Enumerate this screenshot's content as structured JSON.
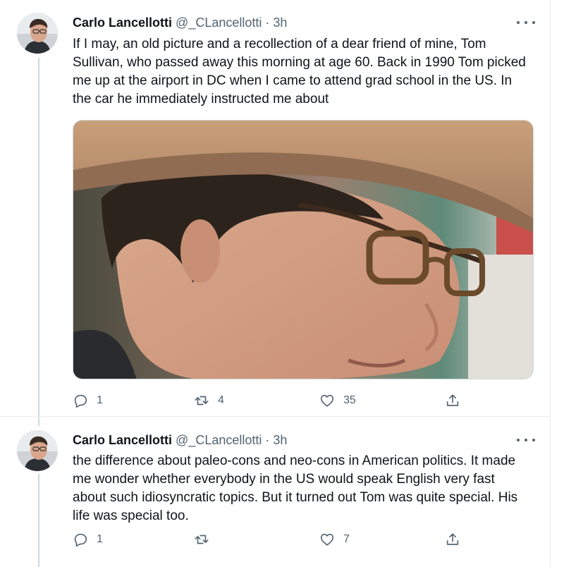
{
  "tweets": [
    {
      "author_name": "Carlo Lancellotti",
      "handle": "@_CLancellotti",
      "separator": "·",
      "time": "3h",
      "text": "If I may, an old picture and a recollection of a dear friend of mine, Tom Sullivan, who passed away this morning at age 60. Back in 1990 Tom picked me up at the airport in DC when I came to attend grad school in the US. In the car he immediately instructed me about",
      "has_media": true,
      "replies": "1",
      "retweets": "4",
      "likes": "35"
    },
    {
      "author_name": "Carlo Lancellotti",
      "handle": "@_CLancellotti",
      "separator": "·",
      "time": "3h",
      "text": "the difference about paleo-cons and neo-cons in American politics. It made me wonder whether everybody in the US would speak English very fast about such idiosyncratic topics. But it turned out Tom was quite special. His life was special too.",
      "has_media": false,
      "replies": "1",
      "retweets": "",
      "likes": "7"
    }
  ],
  "icons": {
    "reply": "reply-icon",
    "retweet": "retweet-icon",
    "like": "heart-icon",
    "share": "share-icon",
    "more": "more-options-icon"
  },
  "colors": {
    "text_primary": "#0f1419",
    "text_secondary": "#536471",
    "thread_line": "#cfd9de",
    "divider": "#e6ecf0"
  }
}
